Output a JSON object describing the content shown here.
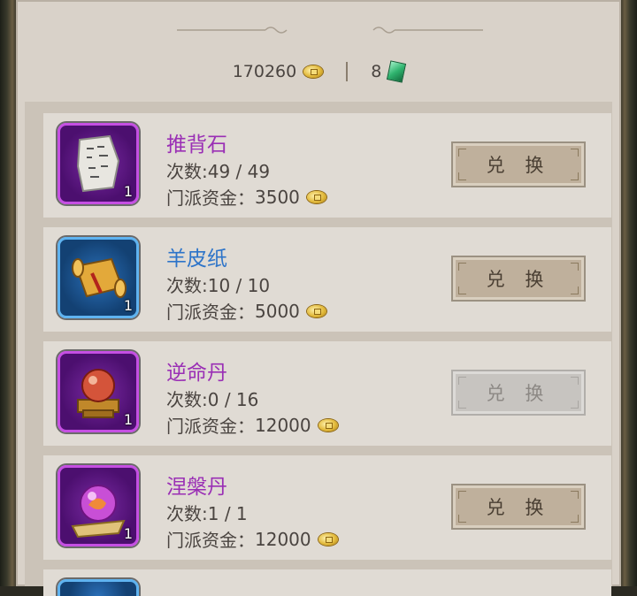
{
  "currency": {
    "gold_amount": "170260",
    "gold_icon": "gold-coin-icon",
    "jade_amount": "8",
    "jade_icon": "jade-gem-icon"
  },
  "items": [
    {
      "name": "推背石",
      "times": "次数:49 / 49",
      "cost_label": "门派资金：",
      "cost": "3500",
      "count": "1",
      "rarity": "purple",
      "button": "兑 换",
      "enabled": true,
      "icon": "stone-tablet-icon"
    },
    {
      "name": "羊皮纸",
      "times": "次数:10 / 10",
      "cost_label": "门派资金：",
      "cost": "5000",
      "count": "1",
      "rarity": "blue",
      "button": "兑 换",
      "enabled": true,
      "icon": "scroll-icon"
    },
    {
      "name": "逆命丹",
      "times": "次数:0 / 16",
      "cost_label": "门派资金：",
      "cost": "12000",
      "count": "1",
      "rarity": "purple",
      "button": "兑 换",
      "enabled": false,
      "icon": "red-pill-orb-icon"
    },
    {
      "name": "涅槃丹",
      "times": "次数:1 / 1",
      "cost_label": "门派资金：",
      "cost": "12000",
      "count": "1",
      "rarity": "purple",
      "button": "兑 换",
      "enabled": true,
      "icon": "purple-orb-icon"
    }
  ],
  "colors": {
    "purple_name": "#9a2fb5",
    "blue_name": "#2d74c9",
    "panel": "#d9d2c9"
  }
}
